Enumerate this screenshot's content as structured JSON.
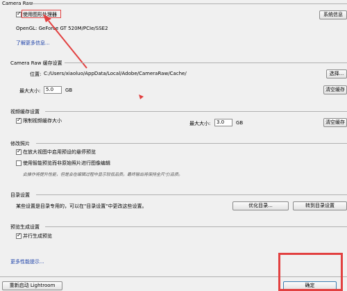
{
  "camera_raw": {
    "title": "Camera Raw",
    "gpu_checkbox_label": "使用图形处理器",
    "gpu_checked": true,
    "system_info_button": "系统信息",
    "opengl_info": "OpenGL: GeForce GT 520M/PCIe/SSE2",
    "learn_more_link": "了解更多信息..."
  },
  "cache": {
    "title": "Camera Raw 缓存设置",
    "location_label": "位置:",
    "location_path": "C:/Users/xiaoluo/AppData/Local/Adobe/CameraRaw/Cache/",
    "select_button": "选择...",
    "max_size_label": "最大大小:",
    "max_size_value": "5.0",
    "max_size_unit": "GB",
    "clear_button": "清空缓存"
  },
  "video_cache": {
    "title": "视频缓存设置",
    "limit_checkbox_label": "限制视频缓存大小",
    "limit_checked": true,
    "max_size_label": "最大大小:",
    "max_size_value": "3.0",
    "max_size_unit": "GB",
    "clear_button": "清空缓存"
  },
  "modify_photos": {
    "title": "修改照片",
    "option1_label": "在放大视图中启用预设的悬停预览",
    "option1_checked": true,
    "option2_label": "使用智能预览而非原始照片进行图像编辑",
    "option2_checked": false,
    "note": "此操作将提升性能，但是会在编辑过程中显示较低品质。最终输出将保持全尺寸/品质。"
  },
  "catalog": {
    "title": "目录设置",
    "description": "某些设置是目录专用的，可以在\"目录设置\"中更改这些设置。",
    "optimize_button": "优化目录...",
    "goto_button": "转到目录设置"
  },
  "preview": {
    "title": "预览生成设置",
    "parallel_label": "并行生成预览",
    "parallel_checked": true
  },
  "footer": {
    "more_tips_link": "更多性能提示...",
    "restart_button": "重新启动 Lightroom",
    "ok_button": "确定"
  },
  "annotation_colors": {
    "highlight": "#e24040"
  }
}
